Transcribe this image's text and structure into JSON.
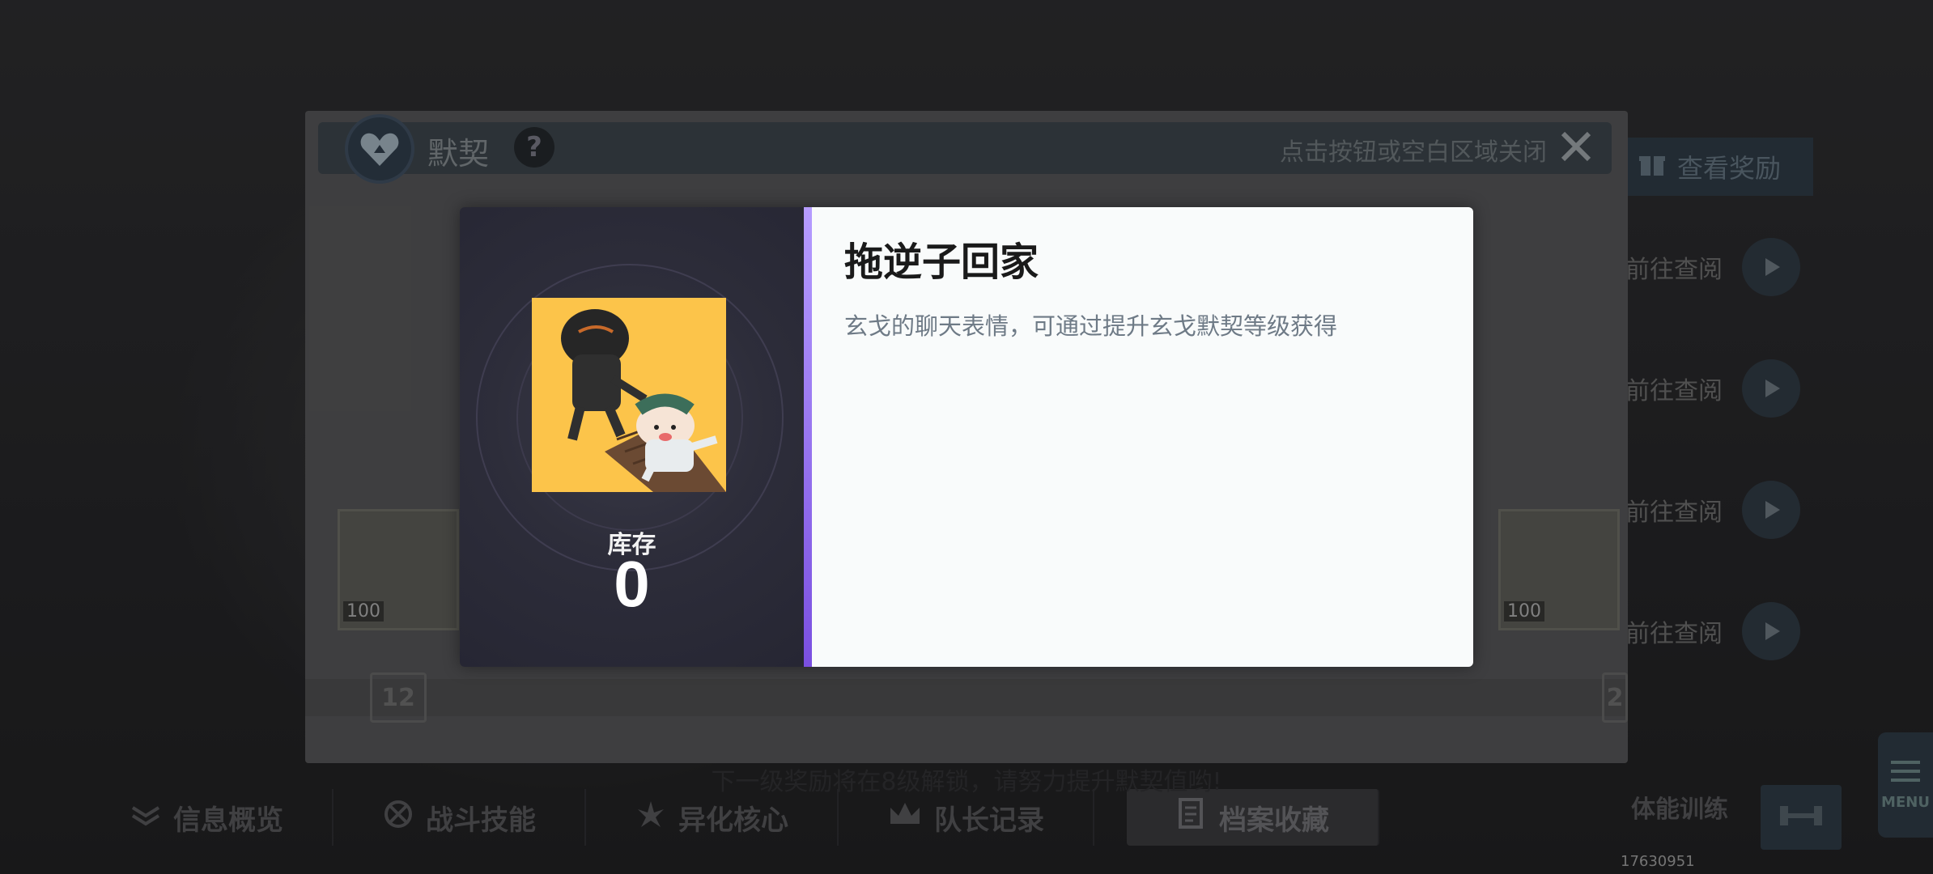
{
  "background": {
    "view_rewards_label": "查看奖励",
    "inquiry_rows": [
      "前往查阅",
      "前往查阅",
      "前往查阅",
      "前往查阅"
    ],
    "bottom_tabs": [
      {
        "label": "信息概览",
        "icon": "info-icon"
      },
      {
        "label": "战斗技能",
        "icon": "battle-icon"
      },
      {
        "label": "异化核心",
        "icon": "core-icon"
      },
      {
        "label": "队长记录",
        "icon": "crown-icon"
      },
      {
        "label": "档案收藏",
        "icon": "archive-icon",
        "active": true
      }
    ],
    "training_label": "体能训练",
    "menu_label": "MENU",
    "uid": "17630951"
  },
  "modal": {
    "title": "默契",
    "help_label": "?",
    "close_hint": "点击按钮或空白区域关闭",
    "left_item_count": "100",
    "right_item_count": "100",
    "gift_left_level": "12",
    "gift_right_level": "2",
    "unlock_hint": "下一级奖励将在8级解锁，请努力提升默契值哟!"
  },
  "detail": {
    "stock_label": "库存",
    "stock_value": "0",
    "item_name": "拖逆子回家",
    "item_description": "玄戈的聊天表情，可通过提升玄戈默契等级获得"
  },
  "colors": {
    "accent_purple": "#8a5cf0",
    "sticker_bg": "#fcc44a",
    "detail_bg": "#f9fbfb"
  }
}
